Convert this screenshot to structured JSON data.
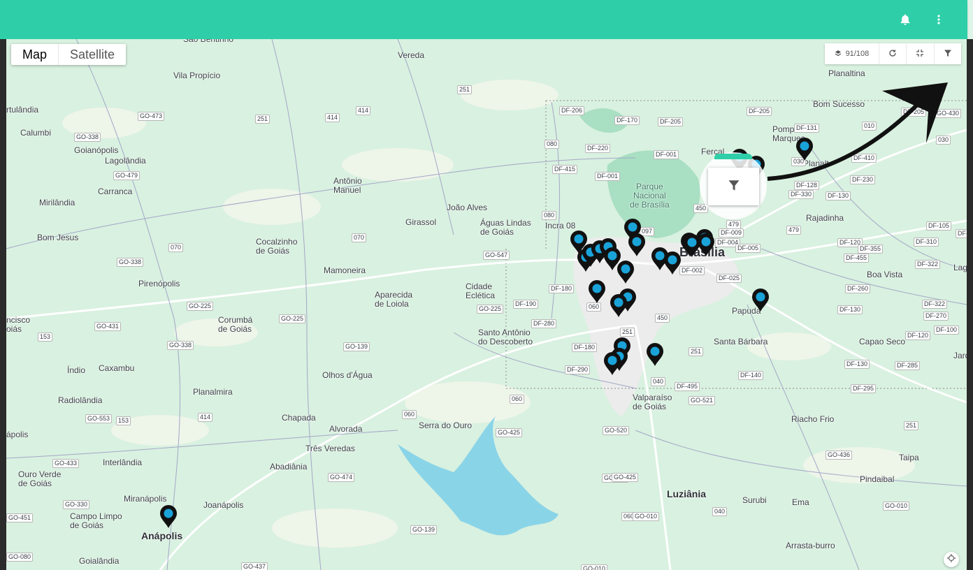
{
  "header": {
    "notifications_icon": "bell-icon",
    "menu_icon": "more-vert-icon"
  },
  "map_type": {
    "map_label": "Map",
    "satellite_label": "Satellite",
    "selected": "Map"
  },
  "controls": {
    "count_label": "91/108",
    "count_icon": "layers-icon",
    "refresh_icon": "refresh-icon",
    "collapse_icon": "collapse-icon",
    "filter_icon": "filter-icon"
  },
  "callout": {
    "icon": "filter-icon",
    "accent": "#2ecfa8"
  },
  "colors": {
    "topbar": "#2ecfa8",
    "pin_fill": "#1aa3d9",
    "pin_border": "#111111",
    "map_bg": "#d9f1e0"
  },
  "places": [
    {
      "id": "sao-bentinho",
      "text": "São Bentinho"
    },
    {
      "id": "vereda",
      "text": "Vereda"
    },
    {
      "id": "vila-propicio",
      "text": "Vila Propício"
    },
    {
      "id": "artulandia",
      "text": "rtulândia"
    },
    {
      "id": "calumbi",
      "text": "Calumbi"
    },
    {
      "id": "goianopolis",
      "text": "Goianópolis"
    },
    {
      "id": "lagolandia",
      "text": "Lagolândia"
    },
    {
      "id": "carranca",
      "text": "Carranca"
    },
    {
      "id": "mirilandia",
      "text": "Mirilândia"
    },
    {
      "id": "antonio-manuel",
      "text": "Antônio\nManuel"
    },
    {
      "id": "joao-alves",
      "text": "João Alves"
    },
    {
      "id": "girassol",
      "text": "Girassol"
    },
    {
      "id": "aguas-lindas",
      "text": "Águas Lindas\nde Goiás"
    },
    {
      "id": "incra-08",
      "text": "Incra 08"
    },
    {
      "id": "bom-jesus",
      "text": "Bom Jesus"
    },
    {
      "id": "cocalzinho",
      "text": "Cocalzinho\nde Goiás"
    },
    {
      "id": "mamoneira",
      "text": "Mamoneira"
    },
    {
      "id": "pirenopolis",
      "text": "Pirenópolis"
    },
    {
      "id": "aparecida-loiola",
      "text": "Aparecida\nde Loiola"
    },
    {
      "id": "cidade-ecletica",
      "text": "Cidade\nEclética"
    },
    {
      "id": "santo-antonio",
      "text": "Santo Antônio\ndo Descoberto"
    },
    {
      "id": "corumba",
      "text": "Corumbá\nde Goiás"
    },
    {
      "id": "cisco",
      "text": "ncisco\noiás"
    },
    {
      "id": "caxambu",
      "text": "Caxambu"
    },
    {
      "id": "indio",
      "text": "Índio"
    },
    {
      "id": "olhos-dagua",
      "text": "Olhos d'Água"
    },
    {
      "id": "radiolandia",
      "text": "Radiolândia"
    },
    {
      "id": "planalmira",
      "text": "Planalmira"
    },
    {
      "id": "chapada",
      "text": "Chapada"
    },
    {
      "id": "alvorada",
      "text": "Alvorada"
    },
    {
      "id": "serra-do-ouro",
      "text": "Serra do Ouro"
    },
    {
      "id": "tres-veredas",
      "text": "Três Veredas"
    },
    {
      "id": "apolis",
      "text": "ápolis"
    },
    {
      "id": "interlandia",
      "text": "Interlândia"
    },
    {
      "id": "ouro-verde",
      "text": "Ouro Verde\nde Goiás"
    },
    {
      "id": "abadiania",
      "text": "Abadiânia"
    },
    {
      "id": "miranapolis",
      "text": "Miranápolis"
    },
    {
      "id": "joanapolis",
      "text": "Joanápolis"
    },
    {
      "id": "campo-limpo",
      "text": "Campo Limpo\nde Goiás"
    },
    {
      "id": "anapolis",
      "text": "Anápolis"
    },
    {
      "id": "goialandia",
      "text": "Goialândia"
    },
    {
      "id": "parque-nacional",
      "text": "Parque\nNacional\nde Brasília"
    },
    {
      "id": "brasilia",
      "text": "Brasília"
    },
    {
      "id": "fercal",
      "text": "Fercal"
    },
    {
      "id": "planaltina",
      "text": "Planaltina"
    },
    {
      "id": "bom-sucesso",
      "text": "Bom Sucesso"
    },
    {
      "id": "pompilio",
      "text": "Pompílio\nMarques"
    },
    {
      "id": "planaltina2",
      "text": "Planalt"
    },
    {
      "id": "rajadinha",
      "text": "Rajadinha"
    },
    {
      "id": "boa-vista",
      "text": "Boa Vista"
    },
    {
      "id": "papuda",
      "text": "Papuda"
    },
    {
      "id": "santa-barbara",
      "text": "Santa Bárbara"
    },
    {
      "id": "capao-seco",
      "text": "Capao Seco"
    },
    {
      "id": "jardim",
      "text": "Jardin"
    },
    {
      "id": "valparaiso",
      "text": "Valparaíso\nde Goiás"
    },
    {
      "id": "riacho-frio",
      "text": "Riacho Frio"
    },
    {
      "id": "taipa",
      "text": "Taipa"
    },
    {
      "id": "pindaibal",
      "text": "Pindaibal"
    },
    {
      "id": "luziania",
      "text": "Luziânia"
    },
    {
      "id": "surubi",
      "text": "Surubi"
    },
    {
      "id": "ema",
      "text": "Ema"
    },
    {
      "id": "arrasta-burro",
      "text": "Arrasta-burro"
    },
    {
      "id": "lagoi",
      "text": "Lagoi"
    }
  ],
  "shields": [
    "GO-473",
    "251",
    "414",
    "251",
    "GO-338",
    "GO-479",
    "251",
    "414",
    "DF-206",
    "DF-170",
    "DF-205",
    "DF-205",
    "080",
    "DF-220",
    "DF-001",
    "DF-415",
    "DF-001",
    "070",
    "070",
    "GO-338",
    "GO-547",
    "080",
    "097",
    "450",
    "DF-009",
    "DF-004",
    "DF-005",
    "479",
    "479",
    "GO-225",
    "GO-431",
    "153",
    "GO-225",
    "GO-338",
    "GO-139",
    "DF-180",
    "060",
    "DF-190",
    "GO-225",
    "DF-280",
    "DF-180",
    "DF-290",
    "251",
    "450",
    "251",
    "DF-002",
    "DF-025",
    "DF-131",
    "010",
    "030",
    "DF-410",
    "DF-230",
    "DF-128",
    "DF-330",
    "DF-130",
    "DF-105",
    "DF-120",
    "DF-355",
    "DF-310",
    "DF-455",
    "DF-322",
    "DF-260",
    "DF-130",
    "DF-322",
    "DF-270",
    "DF-120",
    "DF-100",
    "DF-130",
    "DF-285",
    "DF-140",
    "DF-295",
    "DF-495",
    "GO-521",
    "040",
    "060",
    "060",
    "GO-425",
    "GO-520",
    "GO-425",
    "GO-553",
    "153",
    "414",
    "GO-433",
    "GO-474",
    "GO-330",
    "GO-451",
    "GO-139",
    "060",
    "GO-080",
    "GO-437",
    "GO-010",
    "GO-010",
    "040",
    "GO-436",
    "251",
    "GO-010",
    "DF-205",
    "GO-430",
    "030",
    "DF-10",
    "GO-425"
  ]
}
